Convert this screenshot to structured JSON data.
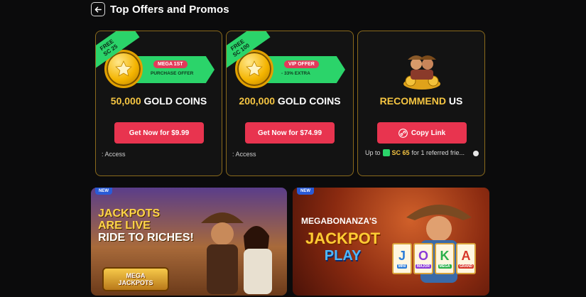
{
  "header": {
    "title": "Top Offers and Promos"
  },
  "offers": [
    {
      "free_line1": "FREE",
      "free_line2": "SC 25",
      "pill": "MEGA 1ST",
      "sub": "PURCHASE OFFER",
      "amount_num": "50,000",
      "amount_label": "GOLD COINS",
      "cta": "Get Now for $9.99",
      "access": ": Access"
    },
    {
      "free_line1": "FREE",
      "free_line2": "SC 100",
      "pill": "VIP OFFER",
      "sub": "- 33% EXTRA",
      "amount_num": "200,000",
      "amount_label": "GOLD COINS",
      "cta": "Get Now for $74.99",
      "access": ": Access"
    }
  ],
  "recommend": {
    "title_gold": "RECOMMEND",
    "title_white": "US",
    "cta": "Copy Link",
    "ref_prefix": "Up to",
    "ref_amount": "SC 65",
    "ref_suffix": "for 1 referred frie..."
  },
  "banners": [
    {
      "badge": "NEW",
      "line1": "JACKPOTS",
      "line2": "ARE LIVE",
      "line3": "RIDE TO RICHES!",
      "logo1": "MEGA",
      "logo2": "JACKPOTS"
    },
    {
      "badge": "NEW",
      "head": "MEGABONANZA'S",
      "jackpot": "JACKPOT",
      "play": "PLAY",
      "cards": [
        {
          "letter": "J",
          "tag": "MINI",
          "color": "#2a7bd7"
        },
        {
          "letter": "O",
          "tag": "MAJOR",
          "color": "#8a3ad7"
        },
        {
          "letter": "K",
          "tag": "MEGA",
          "color": "#2bb04a"
        },
        {
          "letter": "A",
          "tag": "GRAND",
          "color": "#d7372a"
        }
      ]
    }
  ],
  "colors": {
    "accent": "#e8344f",
    "gold": "#f5c542",
    "green": "#2bd46a"
  }
}
